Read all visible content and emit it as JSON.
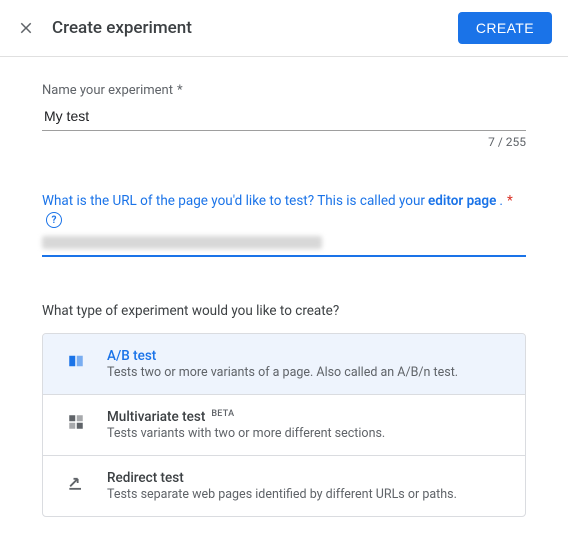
{
  "header": {
    "title": "Create experiment",
    "create_button": "CREATE"
  },
  "name_field": {
    "label": "Name your experiment",
    "required_mark": "*",
    "value": "My test",
    "counter": "7 / 255"
  },
  "url_field": {
    "question_pre": "What is the URL of the page you'd like to test? This is called your ",
    "question_bold": "editor page",
    "question_post": ".",
    "required_mark": "*",
    "value_obscured": true
  },
  "type_section": {
    "question": "What type of experiment would you like to create?",
    "options": [
      {
        "id": "ab",
        "title": "A/B test",
        "desc": "Tests two or more variants of a page. Also called an A/B/n test.",
        "selected": true,
        "beta": false
      },
      {
        "id": "multivariate",
        "title": "Multivariate test",
        "desc": "Tests variants with two or more different sections.",
        "selected": false,
        "beta": true,
        "beta_label": "BETA"
      },
      {
        "id": "redirect",
        "title": "Redirect test",
        "desc": "Tests separate web pages identified by different URLs or paths.",
        "selected": false,
        "beta": false
      }
    ]
  }
}
